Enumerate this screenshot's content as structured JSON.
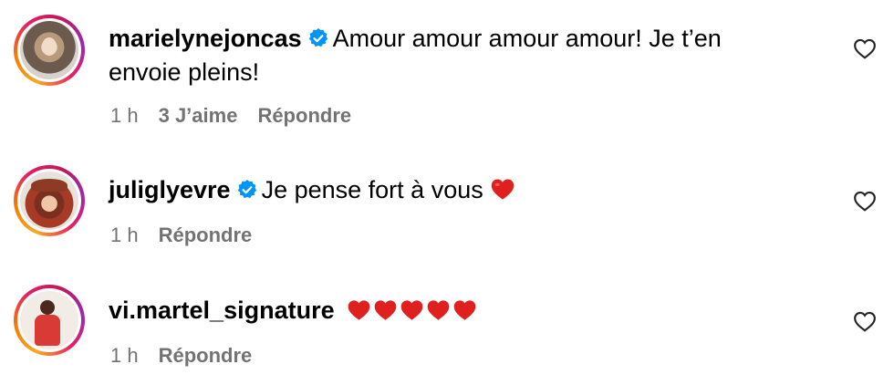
{
  "comments": [
    {
      "username": "marielynejoncas",
      "verified": true,
      "text_line1": "Amour amour amour amour! Je t’en",
      "text_line2": "envoie pleins!",
      "time": "1 h",
      "likes": "3 J’aime",
      "reply": "Répondre"
    },
    {
      "username": "juliglyevre",
      "verified": true,
      "text_line1": "Je pense fort à vous",
      "time": "1 h",
      "reply": "Répondre"
    },
    {
      "username": "vi.martel_signature",
      "verified": false,
      "hearts": 5,
      "time": "1 h",
      "reply": "Répondre"
    }
  ],
  "colors": {
    "verified_blue": "#0095f6",
    "meta_gray": "#737373",
    "heart_red": "#e0201f"
  },
  "icons": [
    "verified-badge-icon",
    "heart-outline-icon",
    "red-heart-emoji-icon"
  ]
}
